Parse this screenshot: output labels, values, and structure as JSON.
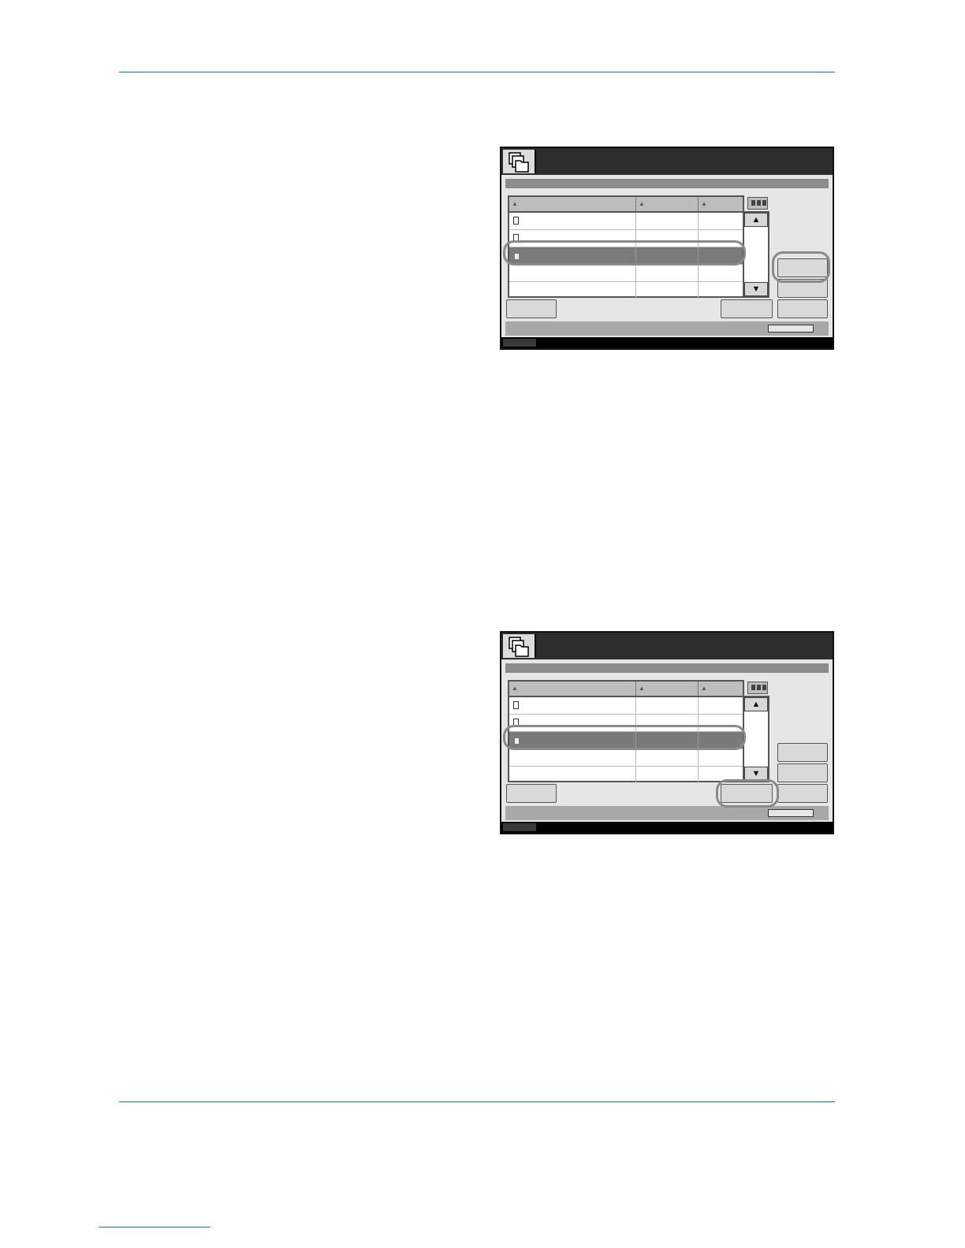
{
  "figures": [
    {
      "label": "document-box-screen-1",
      "highlighted_control": "right-side-button-upper",
      "list": {
        "columns": [
          "",
          "",
          ""
        ],
        "rows": [
          {
            "icon": "document-icon",
            "selected": false
          },
          {
            "icon": "document-icon",
            "selected": false
          },
          {
            "icon": "document-icon",
            "selected": true
          },
          {
            "icon": "",
            "selected": false
          },
          {
            "icon": "",
            "selected": false
          }
        ]
      }
    },
    {
      "label": "document-box-screen-2",
      "highlighted_control": "bottom-button-second-from-right",
      "list": {
        "columns": [
          "",
          "",
          ""
        ],
        "rows": [
          {
            "icon": "document-icon",
            "selected": false
          },
          {
            "icon": "document-icon",
            "selected": false
          },
          {
            "icon": "document-icon",
            "selected": true
          },
          {
            "icon": "",
            "selected": false
          },
          {
            "icon": "",
            "selected": false
          }
        ]
      }
    }
  ],
  "colors": {
    "rule": "#0d76b8",
    "panel_bg": "#e6e6e6",
    "titlebar": "#2d2d2d",
    "selected_row": "#7a7a7a",
    "highlight_ring": "#8a8a8a"
  }
}
